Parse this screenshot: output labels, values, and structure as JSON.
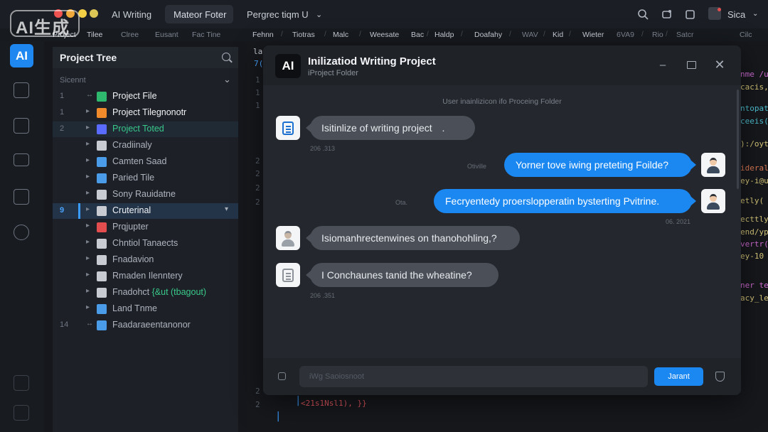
{
  "watermark": "AI生成",
  "titlebar": {
    "app_name": "AI Writing",
    "active_tab": "Mateor Foter",
    "dropdown": "Pergrec tiqm U",
    "user_name": "Sica"
  },
  "menubar": {
    "items": [
      "Project",
      "Tilee",
      "Clree",
      "Eusant",
      "Fac Tine",
      "Fehnn",
      "Tiotras",
      "Malc",
      "Weesate",
      "Bac",
      "Haldp",
      "Doafahy",
      "WAV",
      "Kid",
      "Wieter",
      "6VA9",
      "Rio",
      "Satcr",
      "Cilc"
    ]
  },
  "rail": {
    "logo": "AI",
    "icons": [
      "document-icon",
      "book-icon",
      "folder-icon",
      "mail-icon",
      "settings-icon",
      "terminal-icon",
      "archive-icon"
    ]
  },
  "tree": {
    "title": "Project Tree",
    "section": "Sicennt",
    "rows": [
      {
        "num": "1",
        "label": "Project File",
        "icon_color": "#2fb96f"
      },
      {
        "num": "1",
        "label": "Project Tilegnonotr",
        "icon_color": "#f08a2a"
      },
      {
        "num": "2",
        "label": "Project Toted",
        "icon_color": "#5a6cff"
      },
      {
        "num": "",
        "label": "Cradiinaly",
        "icon_color": "#c8ccd2"
      },
      {
        "num": "",
        "label": "Camten Saad",
        "icon_color": "#4a9be8"
      },
      {
        "num": "",
        "label": "Paried Tile",
        "icon_color": "#4a9be8"
      },
      {
        "num": "",
        "label": "Sony Rauidatne",
        "icon_color": "#c8ccd2"
      },
      {
        "num": "9",
        "label": "Cruterinal",
        "icon_color": "#c8ccd2"
      },
      {
        "num": "",
        "label": "Prqjupter",
        "icon_color": "#e34d4d"
      },
      {
        "num": "",
        "label": "Chntiol Tanaects",
        "icon_color": "#c8ccd2"
      },
      {
        "num": "",
        "label": "Fnadavion",
        "icon_color": "#c8ccd2"
      },
      {
        "num": "",
        "label": "Rmaden Ilenntery",
        "icon_color": "#c8ccd2"
      },
      {
        "num": "",
        "label": "Fnadohct",
        "suffix": "{&ut (tbagout)",
        "icon_color": "#c8ccd2"
      },
      {
        "num": "",
        "label": "Land Tnme",
        "icon_color": "#4a9be8"
      },
      {
        "num": "14",
        "label": "Faadaraeentanonor",
        "icon_color": "#4a9be8"
      }
    ]
  },
  "editor": {
    "gutter": [
      "lac",
      "7(",
      "1",
      "1",
      "1",
      "2",
      "2",
      "2",
      "2",
      "2",
      "2"
    ],
    "right_code": [
      {
        "text": "nme /u",
        "color": "#d16dd4"
      },
      {
        "text": "cacis,(",
        "color": "#d8c87a"
      },
      {
        "text": "ntopat",
        "color": "#4ec3d4"
      },
      {
        "text": "ceeis(",
        "color": "#4ec3d4"
      },
      {
        "text": "):/oyt",
        "color": "#d8c87a"
      },
      {
        "text": "ideraly",
        "color": "#e07a56"
      },
      {
        "text": "ey-i@u",
        "color": "#d8c87a"
      },
      {
        "text": "etly(",
        "color": "#d8c87a"
      },
      {
        "text": "ecttly(x",
        "color": "#d8c87a"
      },
      {
        "text": "end/yp",
        "color": "#d8c87a"
      },
      {
        "text": "vertr(",
        "color": "#d16dd4"
      },
      {
        "text": "ey-10",
        "color": "#d8c87a"
      },
      {
        "text": "ner tey",
        "color": "#d16dd4"
      },
      {
        "text": "acy_ley",
        "color": "#d8c87a"
      }
    ],
    "bottom_code": "<21s1Nsl1), }}"
  },
  "modal": {
    "logo": "AI",
    "title": "Inilizatiod Writing Project",
    "subtitle": "iProject Folder",
    "system_message": "User inainlizicon ifo Proceing Folder",
    "messages": [
      {
        "side": "in",
        "text": "Isitinlize of writing project",
        "trail": ".",
        "avatar": "doc-icon",
        "time": "206 .313"
      },
      {
        "side": "out",
        "text": "Yorner tove iwing preteting Foilde?",
        "avatar": "user-icon",
        "time": "Otiville"
      },
      {
        "side": "out",
        "text": "Fecryentedy proerslopperatin bysterting Pvitrine.",
        "avatar": "user-icon",
        "time": "Ota.",
        "time2": "06. 2021"
      },
      {
        "side": "in",
        "text": "Isiomanhrectenwines on thanohohling,?",
        "avatar": "person-icon"
      },
      {
        "side": "in",
        "text": "I Conchaunes tanid the wheatine?",
        "avatar": "doc-gray-icon",
        "time": "206 .351"
      }
    ],
    "input_placeholder": "iWg Saoiosnoot",
    "send_label": "Jarant"
  }
}
